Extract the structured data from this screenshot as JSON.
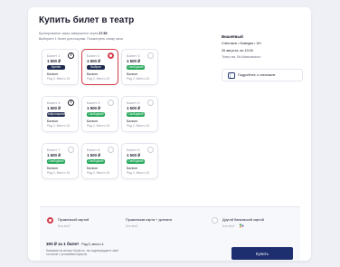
{
  "title": "Купить билет в театр",
  "notes": {
    "line1_prefix": "Бронирование заказ завершится через",
    "timer": "27:59",
    "line2": "Выберите 1 билет для покупки. Посмотреть схему зала"
  },
  "seats": [
    {
      "name": "Билет 1",
      "price": "1 500 ₽",
      "badge": "Куплен",
      "badge_type": "sold",
      "venue": "Балкон",
      "location": "Ряд 2, Место 10",
      "control": "info",
      "selected": false
    },
    {
      "name": "Билет 2",
      "price": "1 500 ₽",
      "badge": "Выбран",
      "badge_type": "sold",
      "venue": "Балкон",
      "location": "Ряд 2, Место 10",
      "control": "radio",
      "selected": true
    },
    {
      "name": "Билет 3",
      "price": "1 500 ₽",
      "badge": "Свободный",
      "badge_type": "free",
      "venue": "Балкон",
      "location": "Ряд 2, Место 10",
      "control": "radio",
      "selected": false
    },
    {
      "name": "Билет 4",
      "price": "1 500 ₽",
      "badge": "Забронирован",
      "badge_type": "sold",
      "venue": "Балкон",
      "location": "Ряд 2, Место 10",
      "control": "info",
      "selected": false
    },
    {
      "name": "Билет 5",
      "price": "1 500 ₽",
      "badge": "Свободный",
      "badge_type": "free",
      "venue": "Балкон",
      "location": "Ряд 2, Место 10",
      "control": "radio",
      "selected": false
    },
    {
      "name": "Билет 6",
      "price": "1 500 ₽",
      "badge": "Свободный",
      "badge_type": "free",
      "venue": "Балкон",
      "location": "Ряд 2, Место 10",
      "control": "radio",
      "selected": false
    },
    {
      "name": "Билет 7",
      "price": "1 600 ₽",
      "badge": "Свободный",
      "badge_type": "free",
      "venue": "Балкон",
      "location": "Ряд 2, Место 10",
      "control": "radio",
      "selected": false
    },
    {
      "name": "Билет 8",
      "price": "1 500 ₽",
      "badge": "Свободный",
      "badge_type": "free",
      "venue": "Балкон",
      "location": "Ряд 2, Место 10",
      "control": "radio",
      "selected": false
    },
    {
      "name": "Билет 9",
      "price": "1 500 ₽",
      "badge": "Свободный",
      "badge_type": "free",
      "venue": "Балкон",
      "location": "Ряд 2, Место 10",
      "control": "radio",
      "selected": false
    }
  ],
  "event": {
    "title": "Вишнёвый",
    "line1": "Спектакль • Комедия • 16+",
    "line2": "26 августа, вс 19:00",
    "line3": "Театр им. Ев.Маяковского",
    "details_label": "Подробнее о спектакле",
    "details_icon": "ticket-icon"
  },
  "payment": {
    "options": [
      {
        "name": "Пушкинской картой",
        "question": "Что это?",
        "selected": true
      },
      {
        "name": "Пушкинская карта + доплата",
        "question": "Что это?",
        "selected": false
      },
      {
        "name": "Другой банковской картой",
        "question": "Что это?",
        "selected": false,
        "icon": "sbp-icon"
      }
    ],
    "summary": "300 ₽ за 1 билет",
    "summary_seat": "Ряд 5, место 4",
    "fine1": "Нажимая на кнопку «Купить», вы подтверждаете своё",
    "fine2": "согласие с условиями оферты",
    "buy_label": "Купить"
  },
  "colors": {
    "accent": "#d43c4a",
    "primary": "#1d2f6f",
    "free": "#24a85a",
    "sold": "#1d2a4e"
  }
}
